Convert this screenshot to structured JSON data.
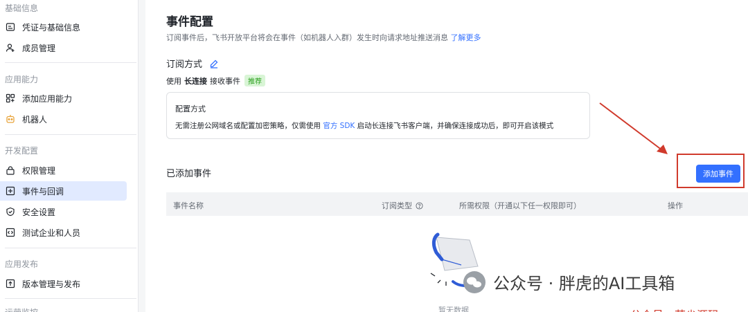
{
  "sidebar": {
    "groups": [
      {
        "label": "基础信息"
      },
      {
        "label": "应用能力"
      },
      {
        "label": "开发配置"
      },
      {
        "label": "应用发布"
      },
      {
        "label": "运营监控"
      }
    ],
    "items": [
      {
        "label": "凭证与基础信息",
        "icon": "credentials-icon"
      },
      {
        "label": "成员管理",
        "icon": "add-user-icon"
      },
      {
        "label": "添加应用能力",
        "icon": "grid-plus-icon"
      },
      {
        "label": "机器人",
        "icon": "robot-icon"
      },
      {
        "label": "权限管理",
        "icon": "lock-icon"
      },
      {
        "label": "事件与回调",
        "icon": "event-icon",
        "active": true
      },
      {
        "label": "安全设置",
        "icon": "shield-icon"
      },
      {
        "label": "测试企业和人员",
        "icon": "code-icon"
      },
      {
        "label": "版本管理与发布",
        "icon": "upload-icon"
      }
    ]
  },
  "main": {
    "title": "事件配置",
    "description": "订阅事件后，飞书开放平台将会在事件（如机器人入群）发生时向请求地址推送消息",
    "learn_more": "了解更多",
    "subscription_title": "订阅方式",
    "subscription_line": {
      "prefix": "使用",
      "method": "长连接",
      "suffix": "接收事件",
      "badge": "推荐"
    },
    "config_card": {
      "title": "配置方式",
      "text_before": "无需注册公网域名或配置加密策略，仅需使用",
      "sdk_link": "官方 SDK",
      "text_after": "启动长连接飞书客户端，并确保连接成功后，即可开启该模式"
    },
    "added_events_title": "已添加事件",
    "add_event_button": "添加事件",
    "table": {
      "columns": [
        "事件名称",
        "订阅类型",
        "所需权限（开通以下任一权限即可）",
        "操作"
      ]
    },
    "empty_text": "暂无数据"
  },
  "watermark": {
    "text": "公众号 · 胖虎的AI工具箱",
    "red_text": "公众号：若尘源码"
  },
  "colors": {
    "accent": "#3370ff",
    "active_bg": "#e1eaff",
    "highlight_red": "#d03a2c",
    "badge_bg": "#d9f5d6",
    "badge_text": "#2ea121"
  }
}
